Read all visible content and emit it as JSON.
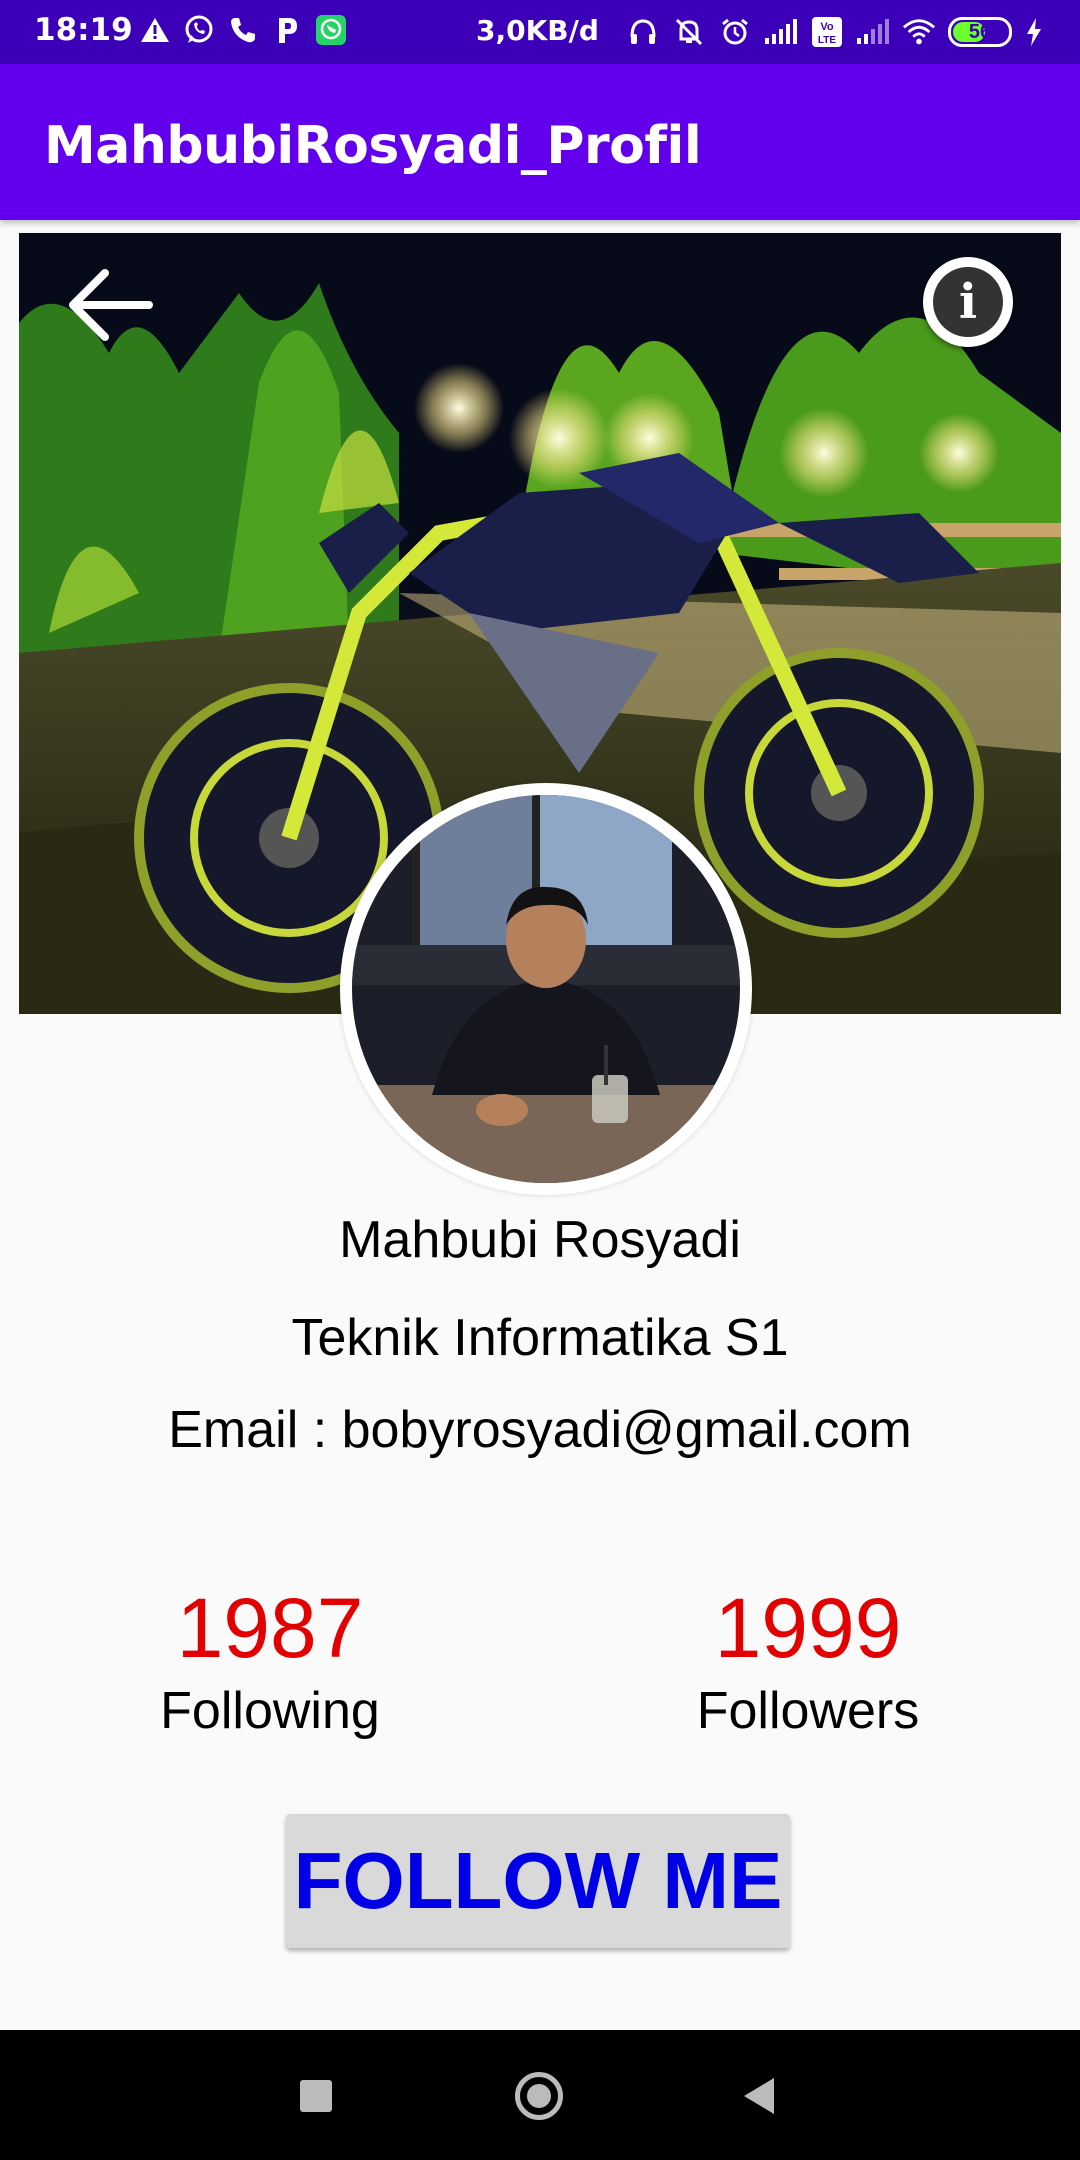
{
  "status_bar": {
    "time": "18:19",
    "speed": "3,0KB/d",
    "battery": "56",
    "left_icons": [
      "warning-icon",
      "whatsapp-icon",
      "phone-icon",
      "p-icon",
      "whatsapp-business-icon"
    ],
    "right_icons": [
      "headset-icon",
      "mute-bell-icon",
      "alarm-icon",
      "signal-icon",
      "volte-icon",
      "signal-2-icon",
      "wifi-icon",
      "battery-icon",
      "charging-icon"
    ]
  },
  "app_bar": {
    "title": "MahbubiRosyadi_Profil",
    "color": "#6200ee"
  },
  "profile": {
    "name": "Mahbubi Rosyadi",
    "major": "Teknik Informatika S1",
    "email": "Email : bobyrosyadi@gmail.com"
  },
  "stats": {
    "following": {
      "value": "1987",
      "label": "Following"
    },
    "followers": {
      "value": "1999",
      "label": "Followers"
    },
    "value_color": "#e30000"
  },
  "follow_button": {
    "label": "FOLLOW ME",
    "text_color": "#0000e6"
  },
  "nav_bar": {
    "buttons": [
      "recents-icon",
      "home-icon",
      "back-icon"
    ]
  }
}
